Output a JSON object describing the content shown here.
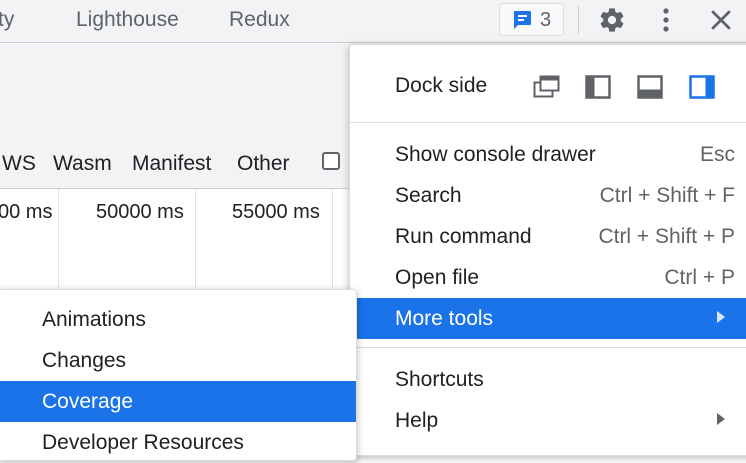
{
  "tabs": [
    {
      "label": "ty"
    },
    {
      "label": "Lighthouse"
    },
    {
      "label": "Redux"
    }
  ],
  "toolbar": {
    "issues_count": "3",
    "settings_icon": "gear-icon",
    "more_icon": "kebab-icon",
    "close_icon": "close-icon"
  },
  "filters": {
    "types": [
      "WS",
      "Wasm",
      "Manifest",
      "Other"
    ]
  },
  "timeline": {
    "ticks": [
      "00 ms",
      "50000 ms",
      "55000 ms"
    ]
  },
  "menu": {
    "dock_side_label": "Dock side",
    "items": [
      {
        "label": "Show console drawer",
        "shortcut": "Esc"
      },
      {
        "label": "Search",
        "shortcut": "Ctrl + Shift + F"
      },
      {
        "label": "Run command",
        "shortcut": "Ctrl + Shift + P"
      },
      {
        "label": "Open file",
        "shortcut": "Ctrl + P"
      },
      {
        "label": "More tools",
        "shortcut": ""
      },
      {
        "label": "Shortcuts",
        "shortcut": ""
      },
      {
        "label": "Help",
        "shortcut": ""
      }
    ]
  },
  "submenu": {
    "items": [
      {
        "label": "Animations"
      },
      {
        "label": "Changes"
      },
      {
        "label": "Coverage"
      },
      {
        "label": "Developer Resources"
      }
    ]
  },
  "colors": {
    "accent": "#1a73e8",
    "panel_bg": "#f1f3f4"
  }
}
